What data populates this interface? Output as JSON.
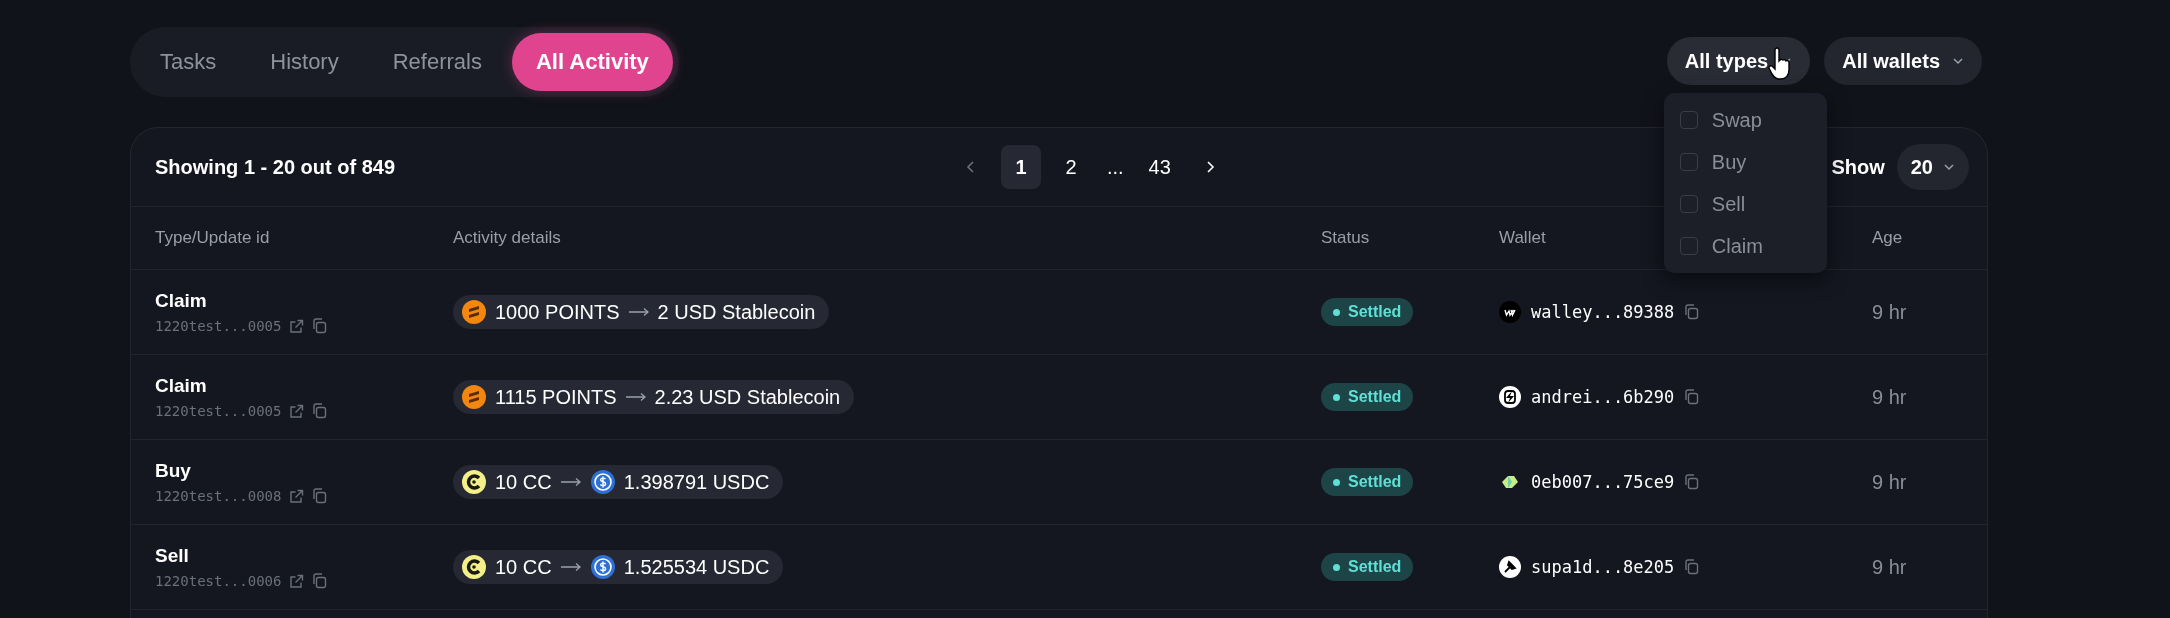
{
  "tabs": [
    {
      "label": "Tasks",
      "selected": false
    },
    {
      "label": "History",
      "selected": false
    },
    {
      "label": "Referrals",
      "selected": false
    },
    {
      "label": "All Activity",
      "selected": true
    }
  ],
  "filters": [
    {
      "label": "All types"
    },
    {
      "label": "All wallets"
    }
  ],
  "type_menu": {
    "open": true,
    "options": [
      {
        "label": "Swap",
        "checked": false
      },
      {
        "label": "Buy",
        "checked": false
      },
      {
        "label": "Sell",
        "checked": false
      },
      {
        "label": "Claim",
        "checked": false
      }
    ]
  },
  "summary": "Showing 1 - 20 out of 849",
  "pagination": {
    "pages": [
      {
        "kind": "page",
        "label": "1",
        "selected": true
      },
      {
        "kind": "page",
        "label": "2",
        "selected": false
      },
      {
        "kind": "ellipsis",
        "label": "..."
      },
      {
        "kind": "page",
        "label": "43",
        "selected": false
      }
    ]
  },
  "page_size": {
    "label": "Show",
    "value": "20"
  },
  "table": {
    "columns": [
      "Type/Update id",
      "Activity details",
      "Status",
      "Wallet",
      "Age"
    ],
    "rows": [
      {
        "type": "Claim",
        "update_id": "1220test...0005",
        "activity": {
          "kind": "claim",
          "from": "1000 POINTS",
          "to": "2 USD Stablecoin"
        },
        "status": "Settled",
        "wallet": "walley...89388",
        "age": "9 hr"
      },
      {
        "type": "Claim",
        "update_id": "1220test...0005",
        "activity": {
          "kind": "claim",
          "from": "1115 POINTS",
          "to": "2.23 USD Stablecoin"
        },
        "status": "Settled",
        "wallet": "andrei...6b290",
        "age": "9 hr"
      },
      {
        "type": "Buy",
        "update_id": "1220test...0008",
        "activity": {
          "kind": "trade",
          "from": "10 CC",
          "to": "1.398791 USDC"
        },
        "status": "Settled",
        "wallet": "0eb007...75ce9",
        "age": "9 hr"
      },
      {
        "type": "Sell",
        "update_id": "1220test...0006",
        "activity": {
          "kind": "trade",
          "from": "10 CC",
          "to": "1.525534 USDC"
        },
        "status": "Settled",
        "wallet": "supa1d...8e205",
        "age": "9 hr"
      }
    ]
  }
}
